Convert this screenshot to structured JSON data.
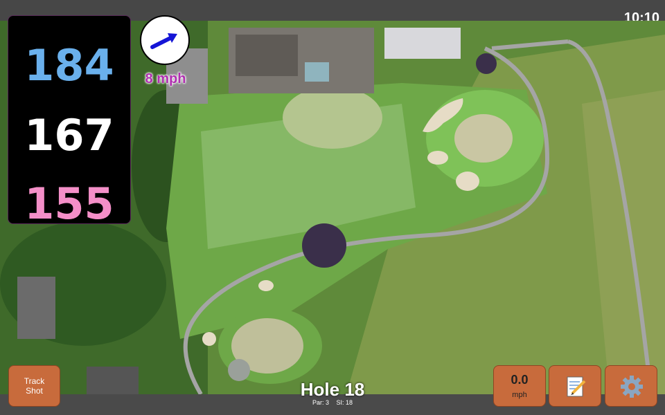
{
  "status_bar": {
    "time": "10:10"
  },
  "yardages": {
    "back": "184",
    "middle": "167",
    "front": "155"
  },
  "wind": {
    "speed_label": "8 mph",
    "button_value": "0.0",
    "button_unit": "mph"
  },
  "hole": {
    "title": "Hole 18",
    "par": "Par: 3",
    "si": "SI: 18"
  },
  "buttons": {
    "track_shot_line1": "Track",
    "track_shot_line2": "Shot"
  },
  "icons": {
    "wind_direction": "arrow-icon",
    "notes": "notepad-icon",
    "settings": "gear-icon"
  },
  "colors": {
    "back_yardage": "#6ab0ec",
    "middle_yardage": "#ffffff",
    "front_yardage": "#f48fc8",
    "button": "#c86b3c",
    "wind_label": "#b02fb0"
  }
}
